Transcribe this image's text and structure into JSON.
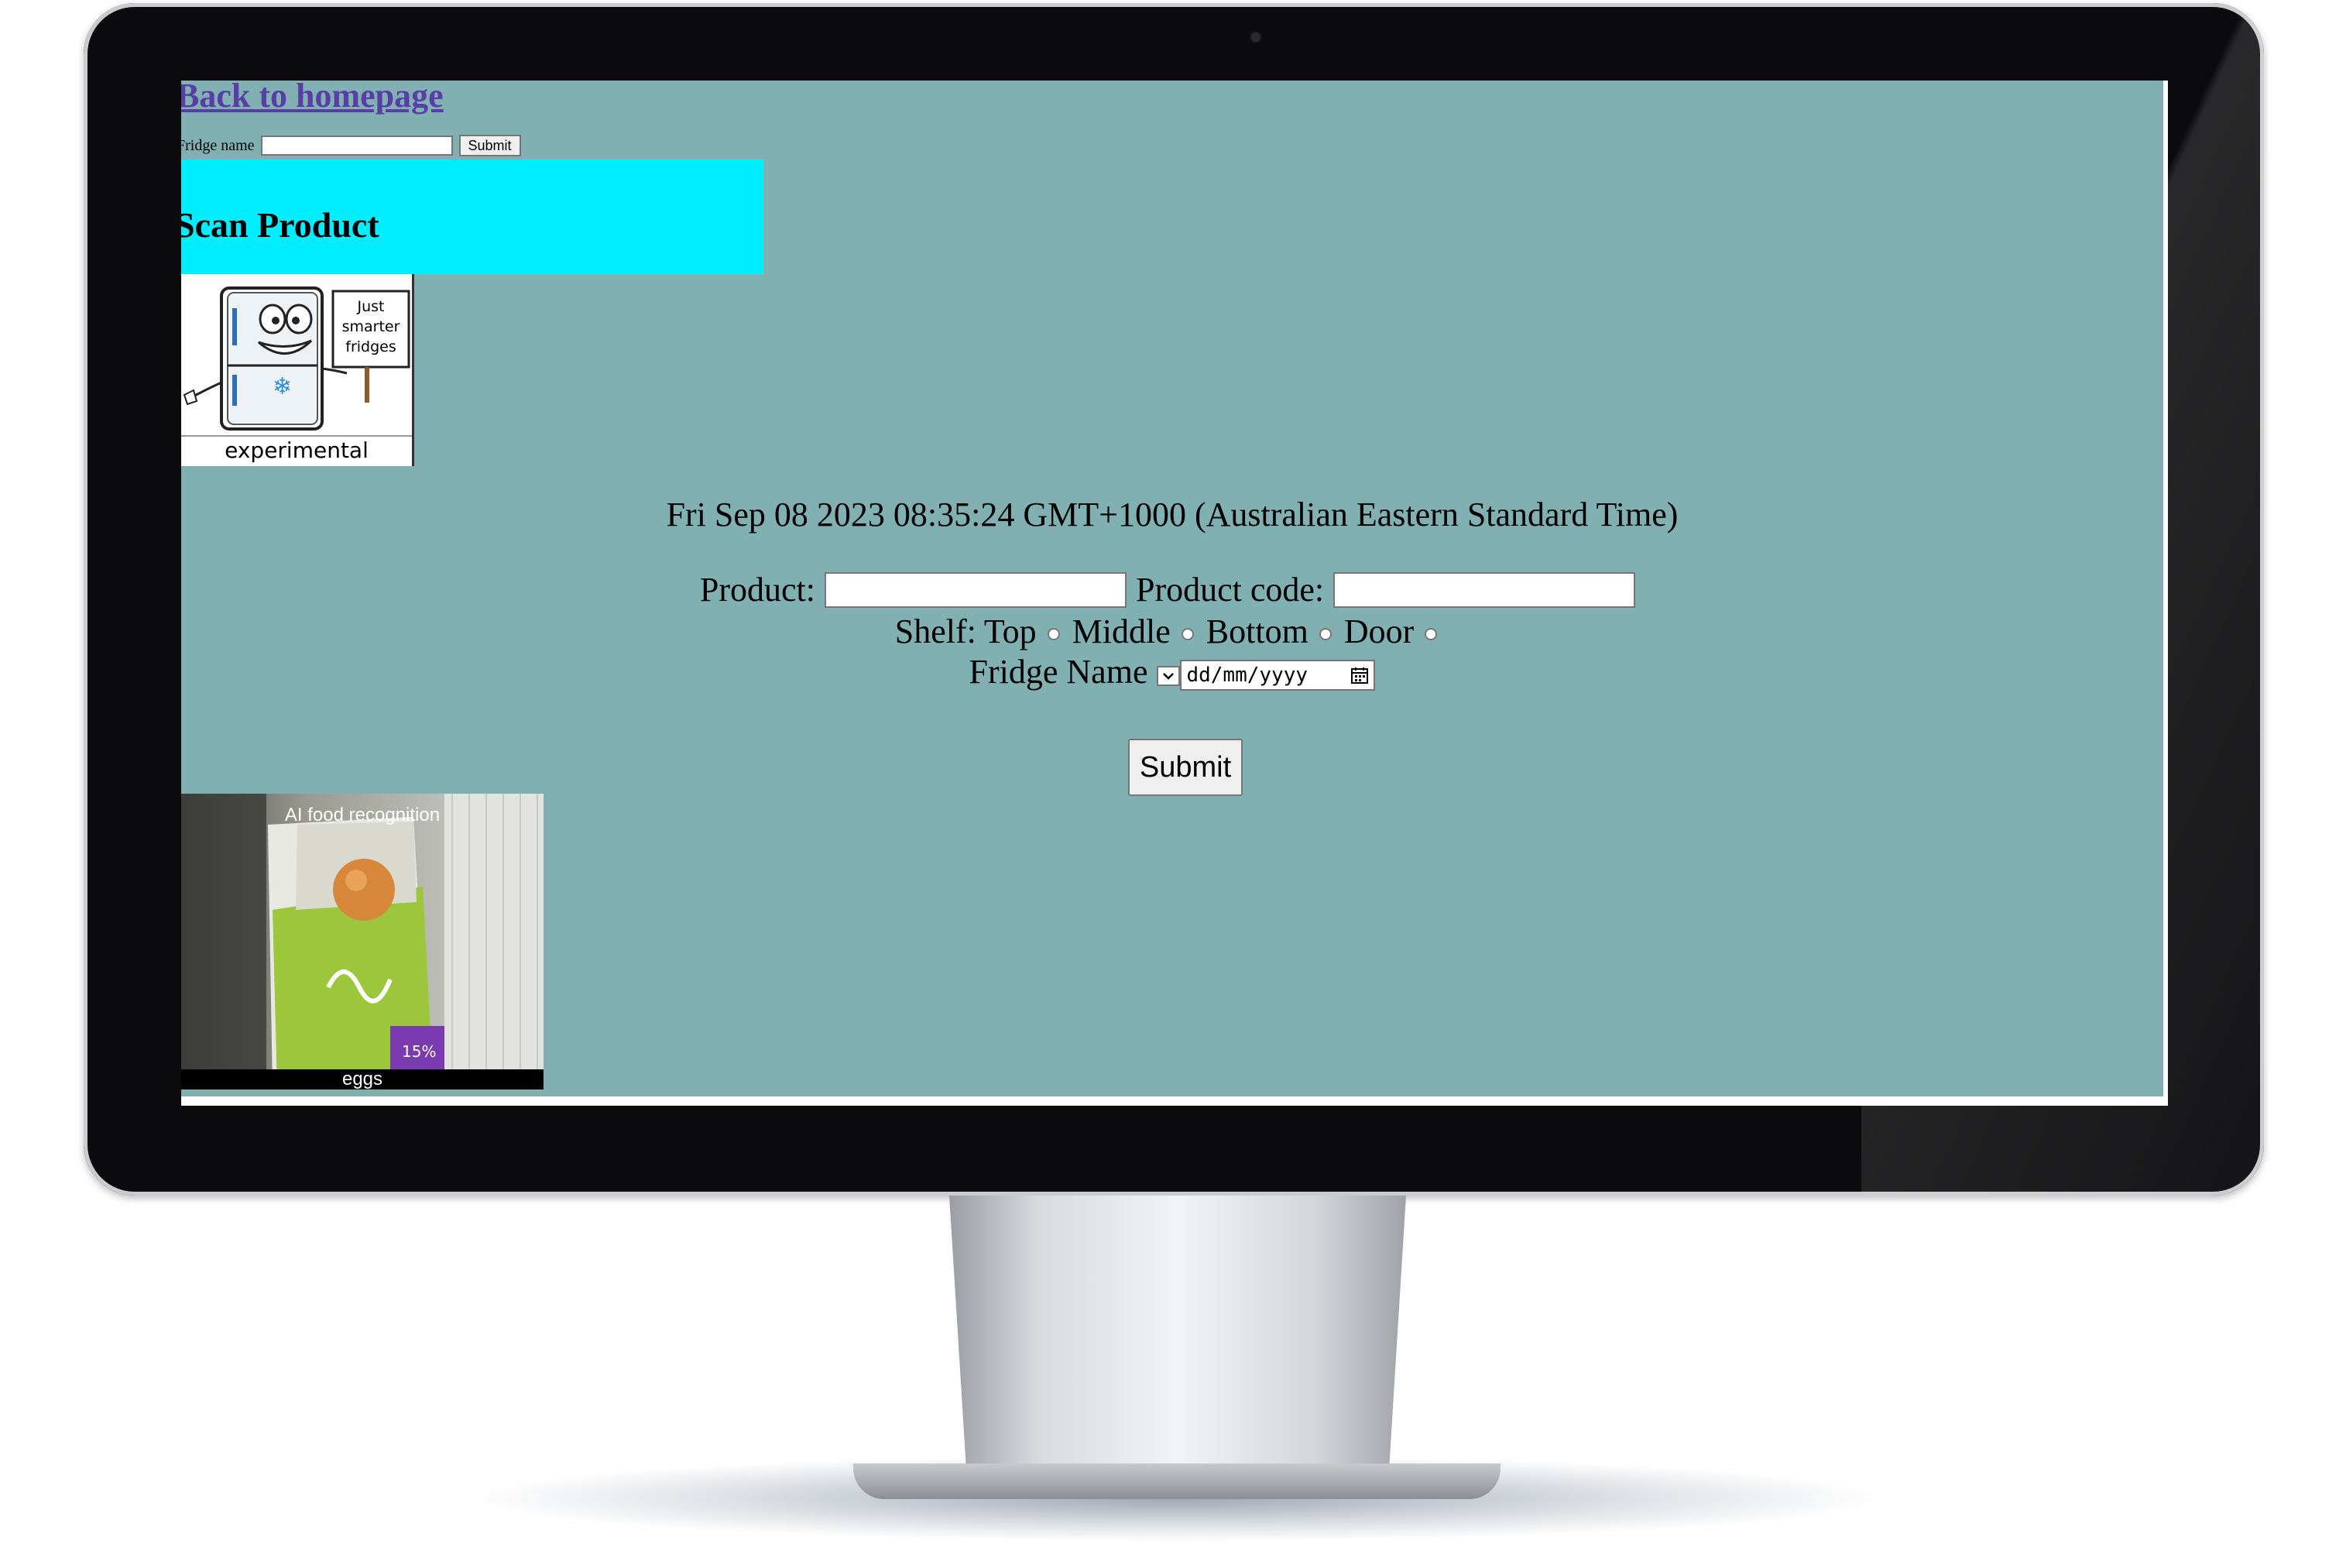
{
  "page": {
    "back_link": "Back to homepage",
    "fridge_form": {
      "label": "Fridge name",
      "submit_label": "Submit"
    },
    "section_title": "Scan Product",
    "logo": {
      "sign_line1": "Just",
      "sign_line2": "smarter",
      "sign_line3": "fridges",
      "caption": "experimental"
    },
    "datetime": "Fri Sep 08 2023 08:35:24 GMT+1000 (Australian Eastern Standard Time)",
    "form": {
      "product_label": "Product:",
      "product_value": "",
      "product_code_label": "Product code:",
      "product_code_value": "",
      "shelf_label": "Shelf:",
      "shelf_options": [
        "Top",
        "Middle",
        "Bottom",
        "Door"
      ],
      "fridge_name_label": "Fridge Name",
      "date_placeholder": "dd/mm/yyyy",
      "submit_label": "Submit"
    },
    "photo": {
      "title": "AI food recognition",
      "caption": "eggs"
    }
  },
  "colors": {
    "screen_bg": "#80b0b2",
    "banner_bg": "#00eeff",
    "link": "#5a3ea8",
    "bezel": "#0b0b0d"
  }
}
